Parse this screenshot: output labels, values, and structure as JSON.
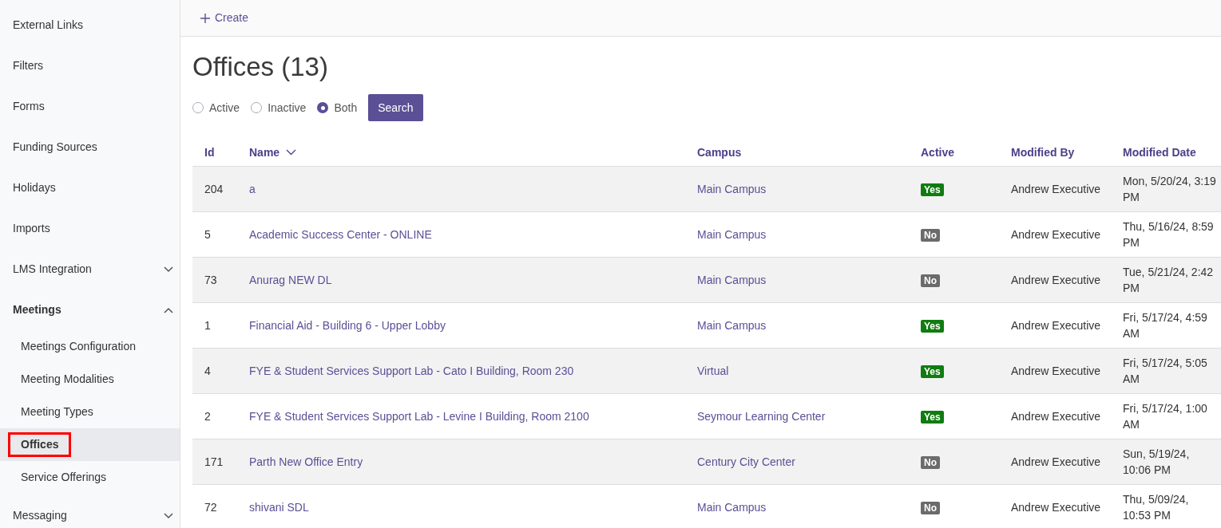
{
  "sidebar": {
    "items": [
      {
        "label": "External Links",
        "selected": false
      },
      {
        "label": "Filters",
        "selected": false
      },
      {
        "label": "Forms",
        "selected": false
      },
      {
        "label": "Funding Sources",
        "selected": false
      },
      {
        "label": "Holidays",
        "selected": false
      },
      {
        "label": "Imports",
        "selected": false
      },
      {
        "label": "LMS Integration",
        "selected": false,
        "expanded": false
      },
      {
        "label": "Meetings",
        "selected": false,
        "expanded": true,
        "children": [
          {
            "label": "Meetings Configuration",
            "selected": false
          },
          {
            "label": "Meeting Modalities",
            "selected": false
          },
          {
            "label": "Meeting Types",
            "selected": false
          },
          {
            "label": "Offices",
            "selected": true
          },
          {
            "label": "Service Offerings",
            "selected": false
          }
        ]
      },
      {
        "label": "Messaging",
        "selected": false,
        "expanded": false
      }
    ]
  },
  "toolbar": {
    "create_label": "Create"
  },
  "title": "Offices (13)",
  "filter": {
    "options": [
      {
        "label": "Active",
        "selected": false
      },
      {
        "label": "Inactive",
        "selected": false
      },
      {
        "label": "Both",
        "selected": true
      }
    ],
    "button": "Search"
  },
  "table": {
    "columns": [
      {
        "label": "Id",
        "sorted": false
      },
      {
        "label": "Name",
        "sorted": true
      },
      {
        "label": "Campus",
        "sorted": false
      },
      {
        "label": "Active",
        "sorted": false
      },
      {
        "label": "Modified By",
        "sorted": false
      },
      {
        "label": "Modified Date",
        "sorted": false
      }
    ],
    "rows": [
      {
        "id": "204",
        "name": "a",
        "campus": "Main Campus",
        "active": true,
        "active_label": "Yes",
        "modified_by": "Andrew Executive",
        "modified_date": "Mon, 5/20/24, 3:19 PM"
      },
      {
        "id": "5",
        "name": "Academic Success Center - ONLINE",
        "campus": "Main Campus",
        "active": false,
        "active_label": "No",
        "modified_by": "Andrew Executive",
        "modified_date": "Thu, 5/16/24, 8:59 PM"
      },
      {
        "id": "73",
        "name": "Anurag NEW DL",
        "campus": "Main Campus",
        "active": false,
        "active_label": "No",
        "modified_by": "Andrew Executive",
        "modified_date": "Tue, 5/21/24, 2:42 PM"
      },
      {
        "id": "1",
        "name": "Financial Aid - Building 6 - Upper Lobby",
        "campus": "Main Campus",
        "active": true,
        "active_label": "Yes",
        "modified_by": "Andrew Executive",
        "modified_date": "Fri, 5/17/24, 4:59 AM"
      },
      {
        "id": "4",
        "name": "FYE & Student Services Support Lab - Cato I Building, Room 230",
        "campus": "Virtual",
        "active": true,
        "active_label": "Yes",
        "modified_by": "Andrew Executive",
        "modified_date": "Fri, 5/17/24, 5:05 AM"
      },
      {
        "id": "2",
        "name": "FYE & Student Services Support Lab - Levine I Building, Room 2100",
        "campus": "Seymour Learning Center",
        "active": true,
        "active_label": "Yes",
        "modified_by": "Andrew Executive",
        "modified_date": "Fri, 5/17/24, 1:00 AM"
      },
      {
        "id": "171",
        "name": "Parth New Office Entry",
        "campus": "Century City Center",
        "active": false,
        "active_label": "No",
        "modified_by": "Andrew Executive",
        "modified_date": "Sun, 5/19/24, 10:06 PM"
      },
      {
        "id": "72",
        "name": "shivani SDL",
        "campus": "Main Campus",
        "active": false,
        "active_label": "No",
        "modified_by": "Andrew Executive",
        "modified_date": "Thu, 5/09/24, 10:53 PM"
      }
    ]
  }
}
